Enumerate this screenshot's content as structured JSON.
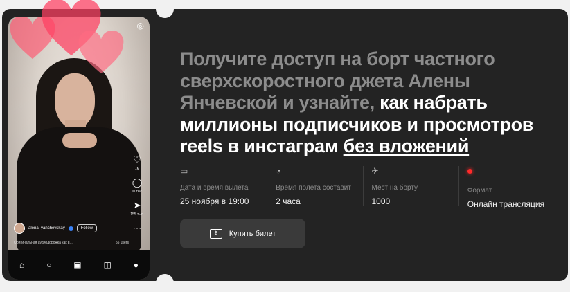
{
  "phone": {
    "username": "alena_yanchevskay",
    "follow_label": "Follow",
    "audio": "Оригинальная аудиодорожка как в...",
    "viewers": "55 users",
    "actions": [
      {
        "icon": "heart-icon",
        "count": "1м"
      },
      {
        "icon": "comment-icon",
        "count": "10 тыс."
      },
      {
        "icon": "share-icon",
        "count": "155 тыс."
      },
      {
        "icon": "more-icon",
        "count": ""
      }
    ],
    "dock_icons": [
      "home-icon",
      "search-icon",
      "reels-icon",
      "shop-icon",
      "profile-icon"
    ]
  },
  "headline": {
    "part1": "Получите доступ на борт частного сверхскоростного джета Алены Янчевской и узнайте,",
    "part2": " как набрать миллионы подписчиков и просмотров reels в инстаграм ",
    "part3": "без вложений"
  },
  "info": [
    {
      "icon": "calendar-icon",
      "label": "Дата и время вылета",
      "value": "25 ноября в 19:00"
    },
    {
      "icon": "clock-icon",
      "label": "Время полета составит",
      "value": "2 часа"
    },
    {
      "icon": "plane-icon",
      "label": "Мест на борту",
      "value": "1000"
    },
    {
      "icon": "live-dot-icon",
      "label": "Формат",
      "value": "Онлайн трансляция"
    }
  ],
  "buy_button": {
    "label": "Купить билет",
    "icon_text": "$"
  },
  "colors": {
    "background": "#232323",
    "accent": "#ff2a2a",
    "button": "#3a3a3a",
    "heart": "#ff4a6a"
  }
}
